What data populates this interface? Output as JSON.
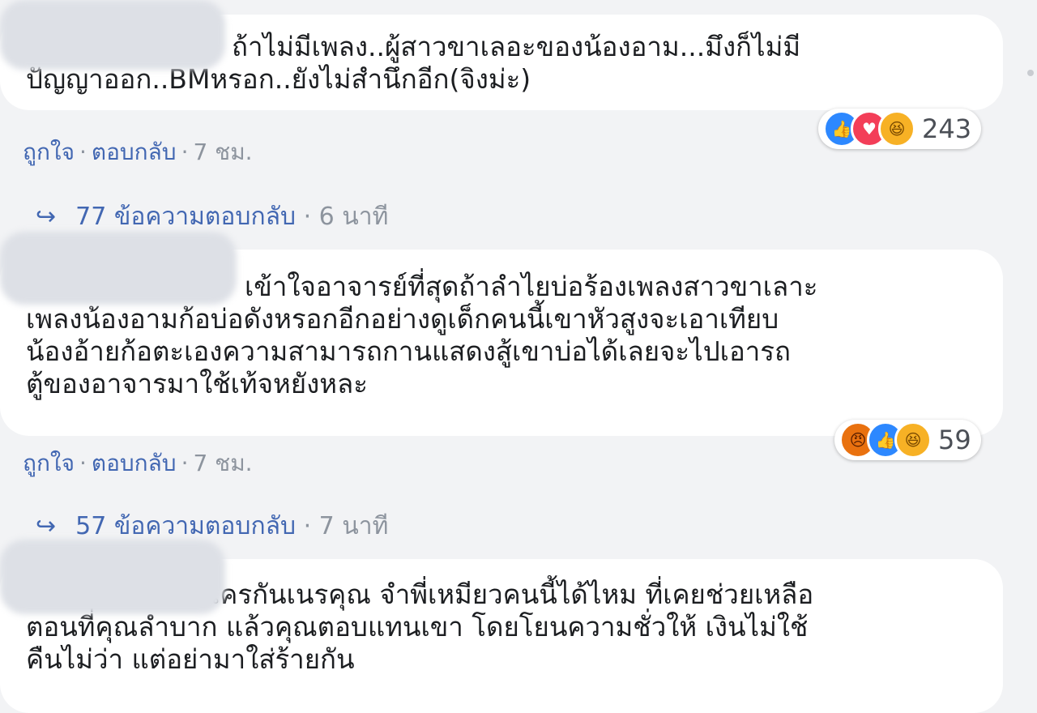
{
  "comments": [
    {
      "text_line1": "ถ้าไม่มีเพลง..ผู้สาวขาเลอะของน้องอาม...มึงก็ไม่มี",
      "text_rest": [
        "ปัญญาออก..BMหรอก..ยังไม่สำนึกอีก(จิงม่ะ)"
      ],
      "reactions": {
        "icons": [
          "like-icon",
          "love-icon",
          "haha-icon"
        ],
        "count": "243"
      },
      "actions": {
        "like": "ถูกใจ",
        "reply": "ตอบกลับ",
        "time": "7 ชม."
      },
      "replies": {
        "count_label": "77 ข้อความตอบกลับ",
        "time": "6 นาที"
      }
    },
    {
      "text_line1": "เข้าใจอาจารย์ที่สุดถ้าลำไยบ่อร้องเพลงสาวขาเลาะ",
      "text_rest": [
        "เพลงน้องอามก้อบ่อดังหรอกอีกอย่างดูเด็กคนนี้เขาหัวสูงจะเอาเทียบ",
        "น้องอ้ายก้อตะเองความสามารถกานแสดงสู้เขาบ่อได้เลยจะไปเอารถ",
        "ตู้ของอาจารมาใช้เท้จหยังหละ"
      ],
      "reactions": {
        "icons": [
          "angry-icon",
          "like-icon",
          "haha-icon"
        ],
        "count": "59"
      },
      "actions": {
        "like": "ถูกใจ",
        "reply": "ตอบกลับ",
        "time": "7 ชม."
      },
      "replies": {
        "count_label": "57 ข้อความตอบกลับ",
        "time": "7 นาที"
      }
    },
    {
      "text_line1": "เครกันเนรคุณ จำพี่เหมียวคนนี้ได้ไหม ที่เคยช่วยเหลือ",
      "text_rest": [
        "ตอนที่คุณลำบาก แล้วคุณตอบแทนเขา โดยโยนความชั่วให้ เงินไม่ใช้",
        "คืนไม่ว่า แต่อย่ามาใส่ร้ายกัน"
      ]
    }
  ],
  "colors": {
    "link": "#4267b2",
    "muted": "#8d949e",
    "background": "#f2f3f5"
  }
}
